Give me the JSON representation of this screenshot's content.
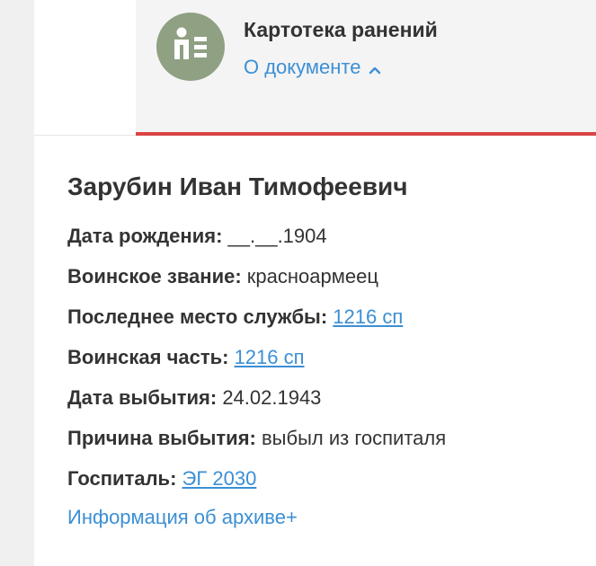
{
  "document": {
    "type_title": "Картотека ранений",
    "about_link": "О документе",
    "icon": "person-card-icon",
    "accent_color": "#d94545",
    "icon_bg_color": "#8fa083",
    "link_color": "#3c8fd4"
  },
  "person": {
    "name": "Зарубин Иван Тимофеевич"
  },
  "fields": [
    {
      "label": "Дата рождения:",
      "value": "__.__.1904"
    },
    {
      "label": "Воинское звание:",
      "value": "красноармеец"
    },
    {
      "label": "Последнее место службы:",
      "value": "1216 сп"
    },
    {
      "label": "Воинская часть:",
      "value": "1216 сп"
    },
    {
      "label": "Дата выбытия:",
      "value": "24.02.1943"
    },
    {
      "label": "Причина выбытия:",
      "value": "выбыл из госпиталя"
    },
    {
      "label": "Госпиталь:",
      "value": "ЭГ 2030"
    }
  ],
  "archive_link": "Информация об архиве+"
}
